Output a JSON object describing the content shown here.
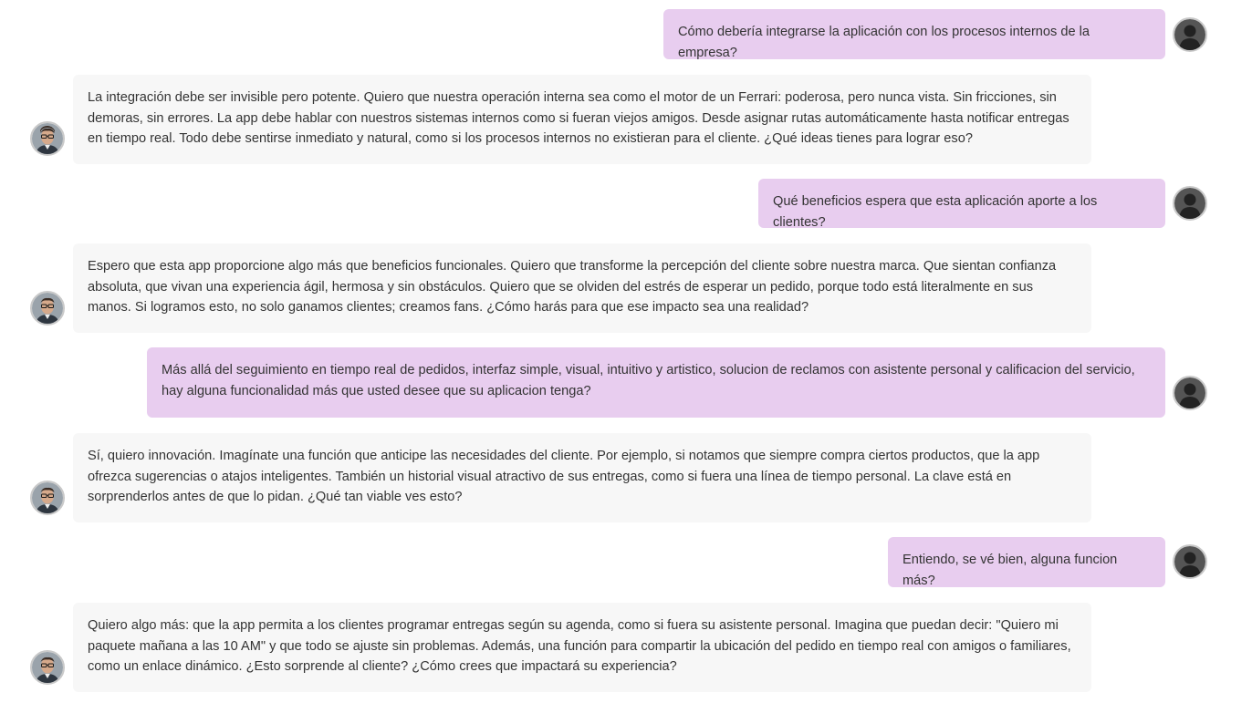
{
  "conversation": {
    "messages": [
      {
        "role": "user",
        "text": "Cómo debería integrarse la aplicación con los procesos internos de la empresa?"
      },
      {
        "role": "assistant",
        "text": "La integración debe ser invisible pero potente. Quiero que nuestra operación interna sea como el motor de un Ferrari: poderosa, pero nunca vista. Sin fricciones, sin demoras, sin errores. La app debe hablar con nuestros sistemas internos como si fueran viejos amigos. Desde asignar rutas automáticamente hasta notificar entregas en tiempo real. Todo debe sentirse inmediato y natural, como si los procesos internos no existieran para el cliente. ¿Qué ideas tienes para lograr eso?"
      },
      {
        "role": "user",
        "text": "Qué beneficios espera que esta aplicación aporte a los clientes?"
      },
      {
        "role": "assistant",
        "text": "Espero que esta app proporcione algo más que beneficios funcionales. Quiero que transforme la percepción del cliente sobre nuestra marca. Que sientan confianza absoluta, que vivan una experiencia ágil, hermosa y sin obstáculos. Quiero que se olviden del estrés de esperar un pedido, porque todo está literalmente en sus manos. Si logramos esto, no solo ganamos clientes; creamos fans. ¿Cómo harás para que ese impacto sea una realidad?"
      },
      {
        "role": "user",
        "text": "Más allá del seguimiento en tiempo real de pedidos, interfaz simple, visual, intuitivo y artistico, solucion de reclamos con asistente personal y calificacion del servicio, hay alguna funcionalidad más que usted desee que su aplicacion tenga?"
      },
      {
        "role": "assistant",
        "text": "Sí, quiero innovación. Imagínate una función que anticipe las necesidades del cliente. Por ejemplo, si notamos que siempre compra ciertos productos, que la app ofrezca sugerencias o atajos inteligentes. También un historial visual atractivo de sus entregas, como si fuera una línea de tiempo personal. La clave está en sorprenderlos antes de que lo pidan. ¿Qué tan viable ves esto?"
      },
      {
        "role": "user",
        "text": "Entiendo, se vé bien, alguna funcion más?"
      },
      {
        "role": "assistant",
        "text": "Quiero algo más: que la app permita a los clientes programar entregas según su agenda, como si fuera su asistente personal. Imagina que puedan decir: \"Quiero mi paquete mañana a las 10 AM\" y que todo se ajuste sin problemas. Además, una función para compartir la ubicación del pedido en tiempo real con amigos o familiares, como un enlace dinámico. ¿Esto sorprende al cliente? ¿Cómo crees que impactará su experiencia?"
      }
    ]
  },
  "colors": {
    "user_bubble": "#e8cdef",
    "assistant_bubble": "#f7f7f7",
    "text": "#333333"
  },
  "icons": {
    "user_avatar": "user-silhouette-icon",
    "assistant_avatar": "man-with-glasses-avatar"
  }
}
